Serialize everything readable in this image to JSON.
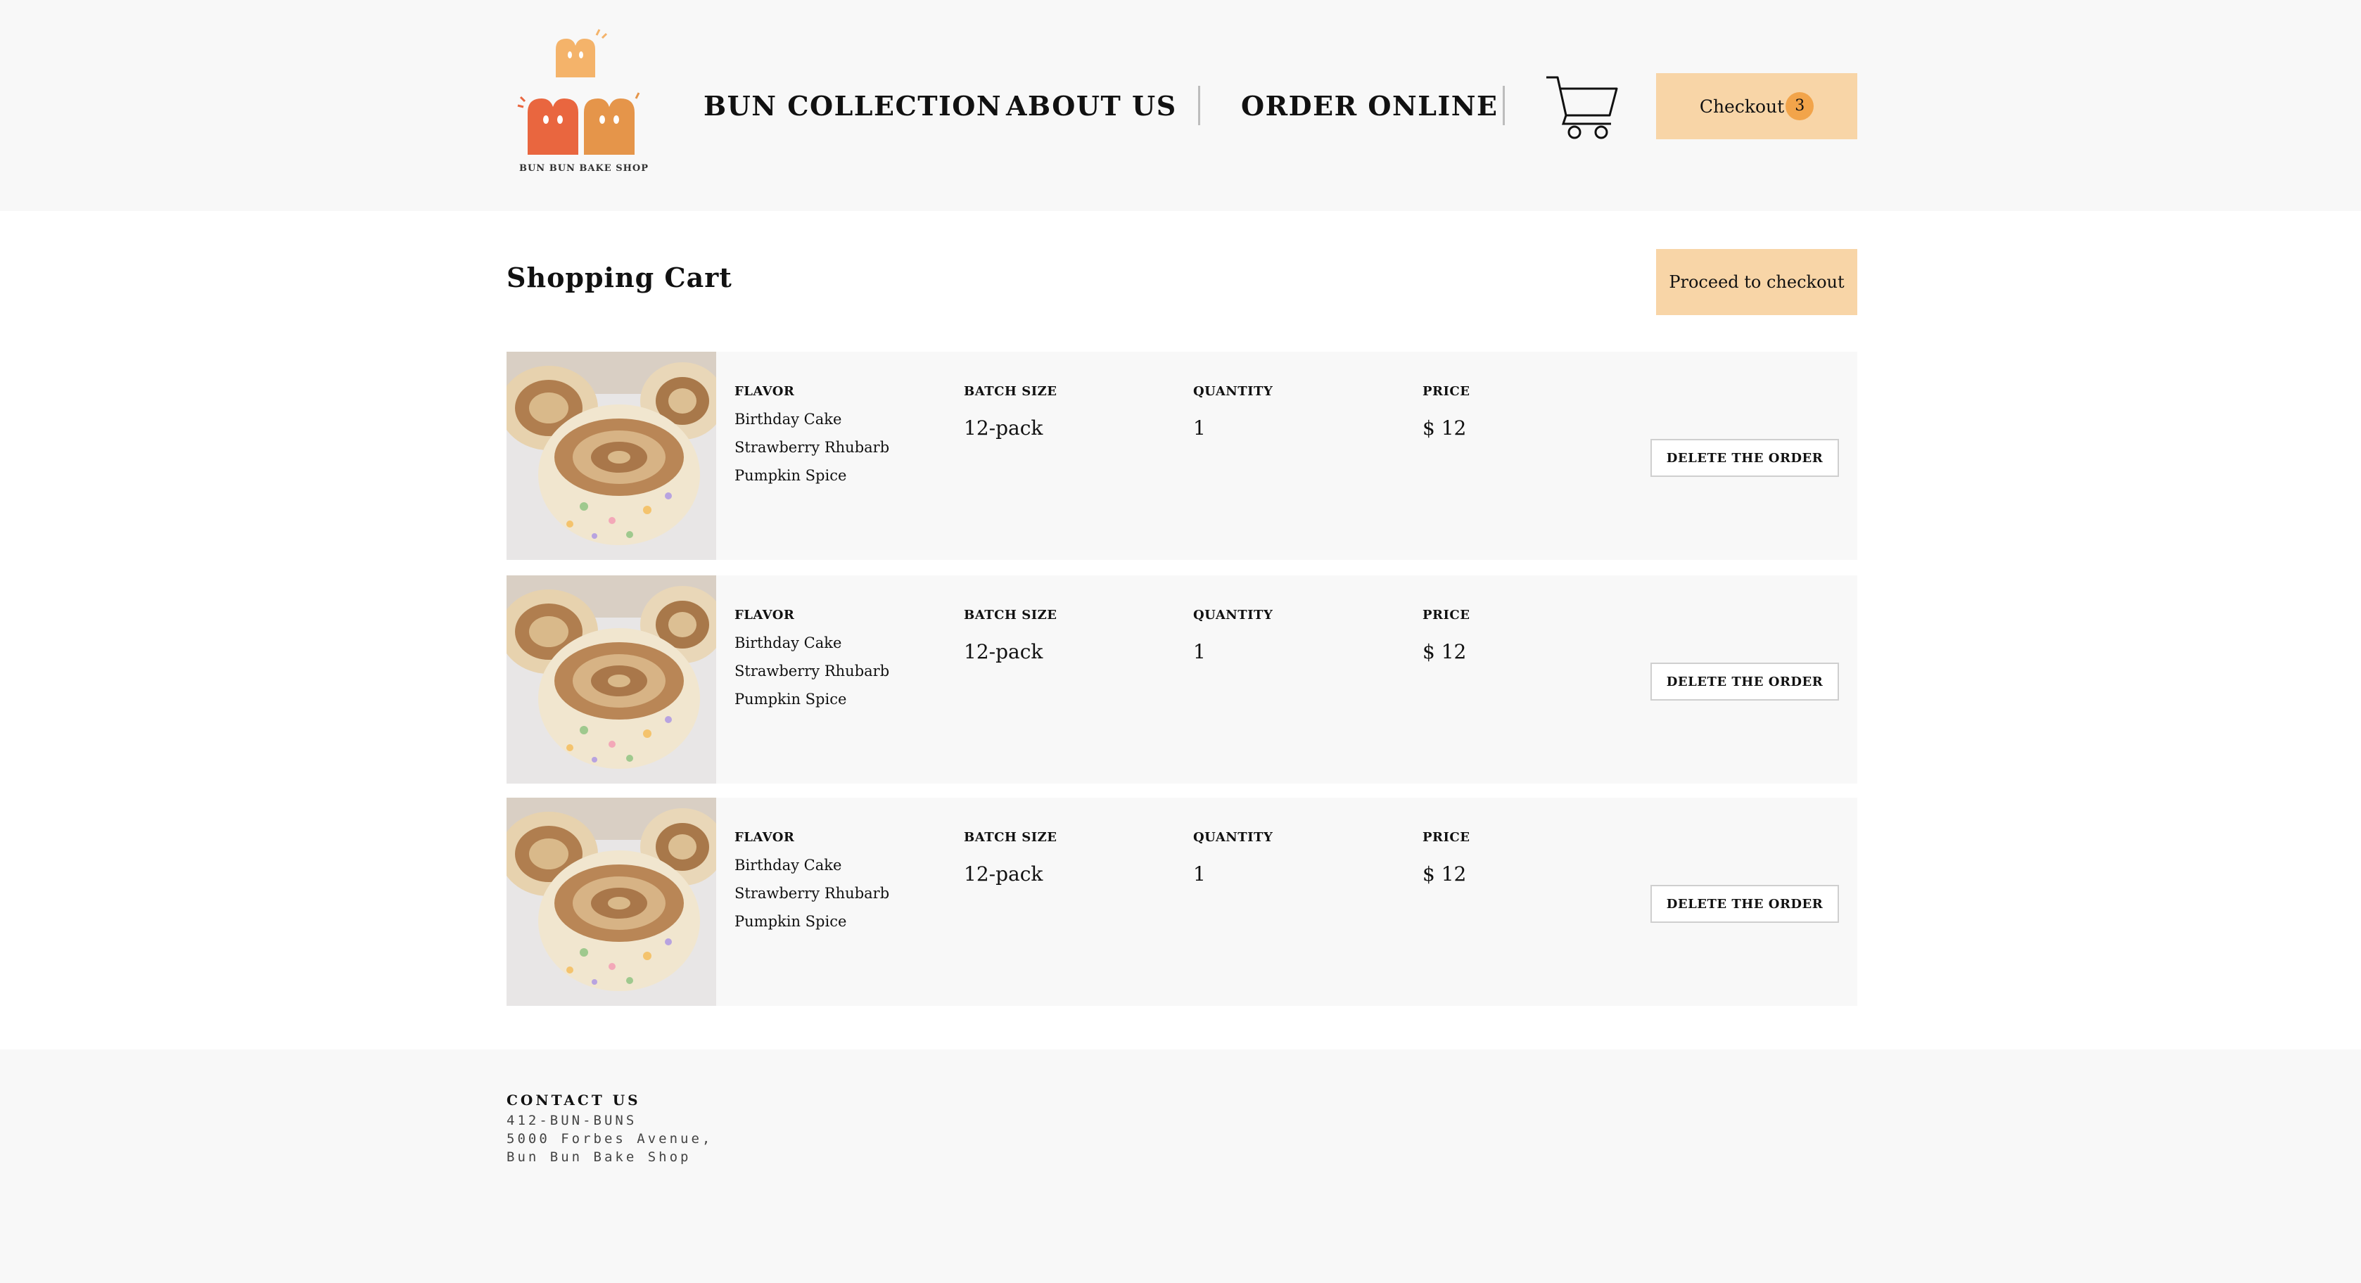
{
  "header": {
    "logo_text": "BUN BUN BAKE SHOP",
    "nav": [
      {
        "label": "BUN COLLECTION"
      },
      {
        "label": "ABOUT US"
      },
      {
        "label": "ORDER ONLINE"
      }
    ],
    "checkout_label": "Checkout",
    "cart_count": "3"
  },
  "cart": {
    "title": "Shopping Cart",
    "proceed_label": "Proceed to checkout",
    "columns": {
      "flavor": "FLAVOR",
      "batch_size": "BATCH SIZE",
      "quantity": "QUANTITY",
      "price": "PRICE"
    },
    "delete_label": "DELETE THE ORDER",
    "items": [
      {
        "flavors": [
          "Birthday Cake",
          "Strawberry Rhubarb",
          "Pumpkin Spice"
        ],
        "batch_size": "12-pack",
        "quantity": "1",
        "price": "$ 12"
      },
      {
        "flavors": [
          "Birthday Cake",
          "Strawberry Rhubarb",
          "Pumpkin Spice"
        ],
        "batch_size": "12-pack",
        "quantity": "1",
        "price": "$ 12"
      },
      {
        "flavors": [
          "Birthday Cake",
          "Strawberry Rhubarb",
          "Pumpkin Spice"
        ],
        "batch_size": "12-pack",
        "quantity": "1",
        "price": "$ 12"
      }
    ]
  },
  "footer": {
    "title": "CONTACT US",
    "phone": "412-BUN-BUNS",
    "address": "5000 Forbes Avenue,",
    "shop": "Bun Bun Bake Shop"
  },
  "colors": {
    "accent": "#f8d5a7",
    "badge": "#f2a44a",
    "panel": "#f8f8f8"
  },
  "icons": [
    "cart-icon",
    "logo-buns"
  ]
}
